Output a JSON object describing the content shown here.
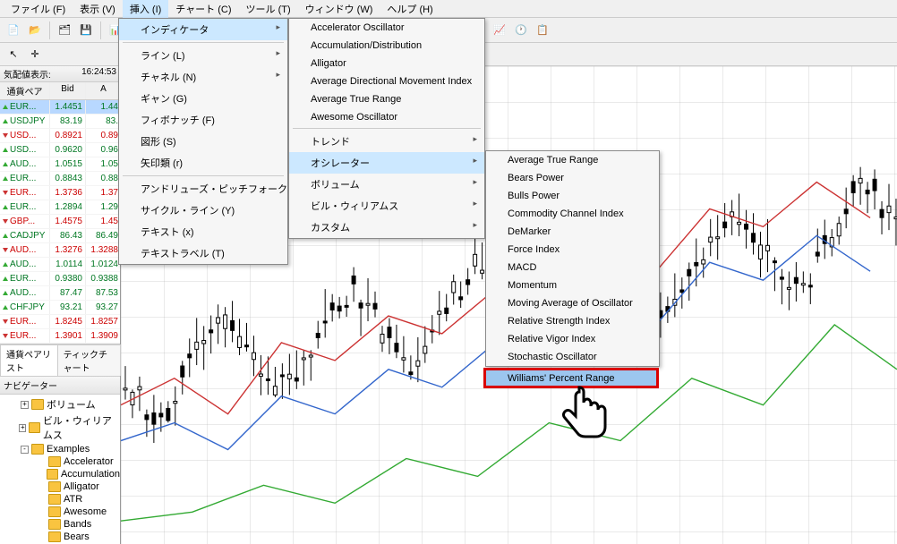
{
  "menubar": {
    "items": [
      {
        "label": "ファイル (F)"
      },
      {
        "label": "表示 (V)"
      },
      {
        "label": "挿入 (I)",
        "active": true
      },
      {
        "label": "チャート (C)"
      },
      {
        "label": "ツール (T)"
      },
      {
        "label": "ウィンドウ (W)"
      },
      {
        "label": "ヘルプ (H)"
      }
    ]
  },
  "market_watch": {
    "title": "気配値表示:",
    "time": "16:24:53",
    "columns": {
      "symbol": "通貨ペア",
      "bid": "Bid",
      "ask": "A"
    },
    "rows": [
      {
        "sym": "EUR...",
        "bid": "1.4451",
        "ask": "1.44",
        "dir": "up",
        "sel": true
      },
      {
        "sym": "USDJPY",
        "bid": "83.19",
        "ask": "83.",
        "dir": "up"
      },
      {
        "sym": "USD...",
        "bid": "0.8921",
        "ask": "0.89",
        "dir": "dn"
      },
      {
        "sym": "USD...",
        "bid": "0.9620",
        "ask": "0.96",
        "dir": "up"
      },
      {
        "sym": "AUD...",
        "bid": "1.0515",
        "ask": "1.05",
        "dir": "up"
      },
      {
        "sym": "EUR...",
        "bid": "0.8843",
        "ask": "0.88",
        "dir": "up"
      },
      {
        "sym": "EUR...",
        "bid": "1.3736",
        "ask": "1.37",
        "dir": "dn"
      },
      {
        "sym": "EUR...",
        "bid": "1.2894",
        "ask": "1.29",
        "dir": "up"
      },
      {
        "sym": "GBP...",
        "bid": "1.4575",
        "ask": "1.45",
        "dir": "dn"
      },
      {
        "sym": "CADJPY",
        "bid": "86.43",
        "ask": "86.49",
        "dir": "up"
      },
      {
        "sym": "AUD...",
        "bid": "1.3276",
        "ask": "1.3288",
        "dir": "dn"
      },
      {
        "sym": "AUD...",
        "bid": "1.0114",
        "ask": "1.0124",
        "dir": "up"
      },
      {
        "sym": "EUR...",
        "bid": "0.9380",
        "ask": "0.9388",
        "dir": "up"
      },
      {
        "sym": "AUD...",
        "bid": "87.47",
        "ask": "87.53",
        "dir": "up"
      },
      {
        "sym": "CHFJPY",
        "bid": "93.21",
        "ask": "93.27",
        "dir": "up"
      },
      {
        "sym": "EUR...",
        "bid": "1.8245",
        "ask": "1.8257",
        "dir": "dn"
      },
      {
        "sym": "EUR...",
        "bid": "1.3901",
        "ask": "1.3909",
        "dir": "dn"
      }
    ],
    "tabs": {
      "a": "通貨ペアリスト",
      "b": "ティックチャート"
    }
  },
  "navigator": {
    "title": "ナビゲーター",
    "items": [
      {
        "label": "ボリューム",
        "exp": "+",
        "depth": 1
      },
      {
        "label": "ビル・ウィリアムス",
        "exp": "+",
        "depth": 1
      },
      {
        "label": "Examples",
        "exp": "-",
        "depth": 1
      },
      {
        "label": "Accelerator",
        "depth": 2
      },
      {
        "label": "Accumulation",
        "depth": 2
      },
      {
        "label": "Alligator",
        "depth": 2
      },
      {
        "label": "ATR",
        "depth": 2
      },
      {
        "label": "Awesome",
        "depth": 2
      },
      {
        "label": "Bands",
        "depth": 2
      },
      {
        "label": "Bears",
        "depth": 2
      }
    ]
  },
  "menu_insert": {
    "items": [
      {
        "label": "インディケータ",
        "sub": true,
        "sel": true
      },
      {
        "sep": true
      },
      {
        "label": "ライン (L)",
        "sub": true
      },
      {
        "label": "チャネル (N)",
        "sub": true
      },
      {
        "label": "ギャン (G)"
      },
      {
        "label": "フィボナッチ (F)"
      },
      {
        "label": "図形 (S)"
      },
      {
        "label": "矢印類 (r)"
      },
      {
        "sep": true
      },
      {
        "label": "アンドリューズ・ピッチフォーク (A)"
      },
      {
        "label": "サイクル・ライン (Y)"
      },
      {
        "label": "テキスト (x)"
      },
      {
        "label": "テキストラベル (T)"
      }
    ]
  },
  "menu_indicators": {
    "items": [
      {
        "label": "Accelerator Oscillator"
      },
      {
        "label": "Accumulation/Distribution"
      },
      {
        "label": "Alligator"
      },
      {
        "label": "Average Directional Movement Index"
      },
      {
        "label": "Average True Range"
      },
      {
        "label": "Awesome Oscillator"
      },
      {
        "sep": true
      },
      {
        "label": "トレンド",
        "sub": true
      },
      {
        "label": "オシレーター",
        "sub": true,
        "sel": true
      },
      {
        "label": "ボリューム",
        "sub": true
      },
      {
        "label": "ビル・ウィリアムス",
        "sub": true
      },
      {
        "label": "カスタム",
        "sub": true
      }
    ]
  },
  "menu_oscillators": {
    "items": [
      {
        "label": "Average True Range"
      },
      {
        "label": "Bears Power"
      },
      {
        "label": "Bulls Power"
      },
      {
        "label": "Commodity Channel Index"
      },
      {
        "label": "DeMarker"
      },
      {
        "label": "Force Index"
      },
      {
        "label": "MACD"
      },
      {
        "label": "Momentum"
      },
      {
        "label": "Moving Average of Oscillator"
      },
      {
        "label": "Relative Strength Index"
      },
      {
        "label": "Relative Vigor Index"
      },
      {
        "label": "Stochastic Oscillator"
      },
      {
        "label": "Williams' Percent Range",
        "highlight": true
      }
    ]
  }
}
